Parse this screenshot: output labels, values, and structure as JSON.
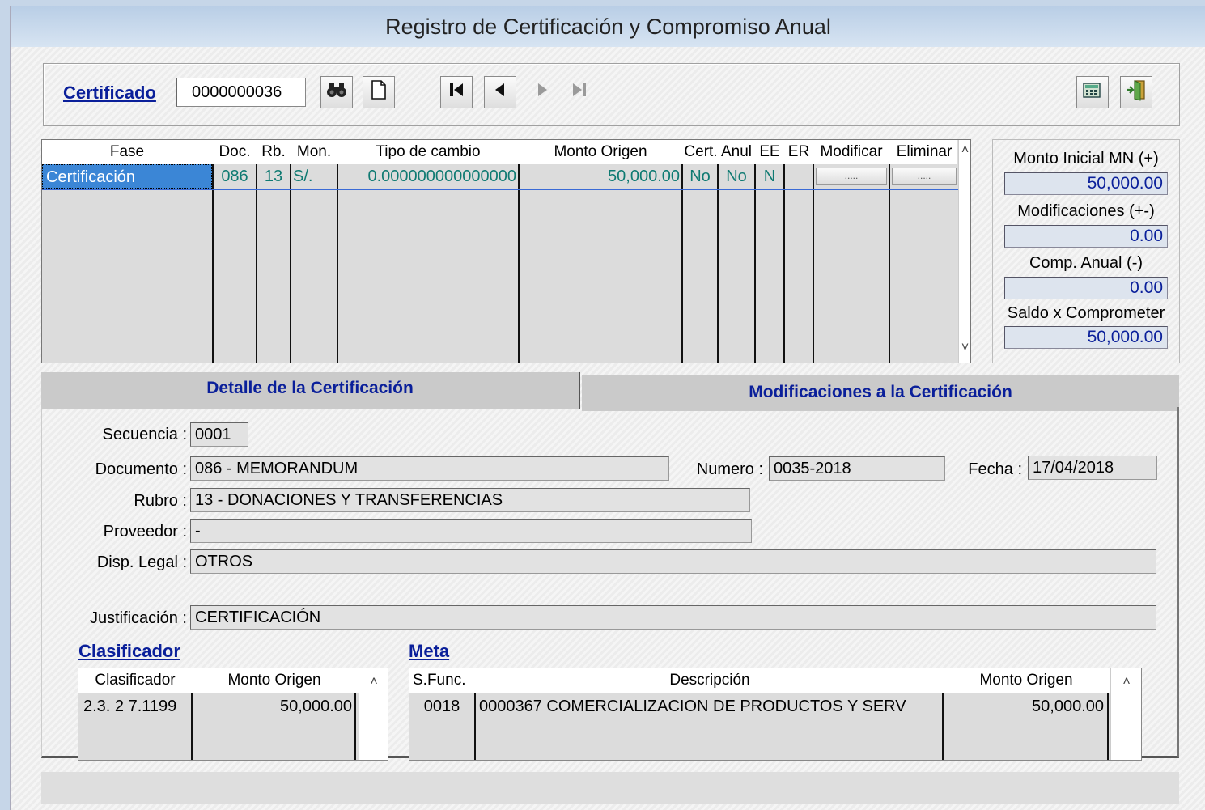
{
  "window": {
    "title": "Registro de Certificación y Compromiso Anual"
  },
  "toolbar": {
    "certificado_label": "Certificado",
    "certificado_value": "0000000036",
    "search_icon": "binoculars-icon",
    "new_icon": "new-document-icon",
    "calc_icon": "calculator-icon",
    "exit_icon": "exit-door-icon"
  },
  "grid": {
    "headers": [
      "Fase",
      "Doc.",
      "Rb.",
      "Mon.",
      "Tipo de cambio",
      "Monto Origen",
      "Cert.",
      "Anul",
      "EE",
      "ER",
      "Modificar",
      "Eliminar"
    ],
    "rows": [
      {
        "fase": "Certificación",
        "doc": "086",
        "rb": "13",
        "mon": "S/.",
        "tipo_cambio": "0.000000000000000",
        "monto_origen": "50,000.00",
        "cert": "No",
        "anul": "No",
        "ee": "N",
        "er": "",
        "modificar": ".....",
        "eliminar": "....."
      }
    ]
  },
  "summary": {
    "monto_inicial_label": "Monto Inicial MN (+)",
    "monto_inicial_value": "50,000.00",
    "modificaciones_label": "Modificaciones (+-)",
    "modificaciones_value": "0.00",
    "comp_anual_label": "Comp. Anual (-)",
    "comp_anual_value": "0.00",
    "saldo_label": "Saldo x Comprometer",
    "saldo_value": "50,000.00"
  },
  "tabs": [
    {
      "label": "Detalle de la Certificación",
      "active": true
    },
    {
      "label": "Modificaciones a la Certificación",
      "active": false
    }
  ],
  "detail": {
    "secuencia_label": "Secuencia :",
    "secuencia_value": "0001",
    "documento_label": "Documento :",
    "documento_value": "086 - MEMORANDUM",
    "numero_label": "Numero :",
    "numero_value": "0035-2018",
    "fecha_label": "Fecha :",
    "fecha_value": "17/04/2018",
    "rubro_label": "Rubro :",
    "rubro_value": "13 - DONACIONES Y TRANSFERENCIAS",
    "proveedor_label": "Proveedor :",
    "proveedor_value": "-",
    "disp_legal_label": "Disp. Legal :",
    "disp_legal_value": "OTROS",
    "justificacion_label": "Justificación :",
    "justificacion_value": "CERTIFICACIÓN"
  },
  "clasificador": {
    "title": "Clasificador",
    "headers": [
      "Clasificador",
      "Monto Origen"
    ],
    "rows": [
      {
        "clasificador": "2.3. 2 7.1199",
        "monto": "50,000.00"
      }
    ]
  },
  "meta": {
    "title": "Meta",
    "headers": [
      "S.Func.",
      "Descripción",
      "Monto Origen"
    ],
    "rows": [
      {
        "sfunc": "0018",
        "descripcion": "0000367  COMERCIALIZACION DE PRODUCTOS Y SERV",
        "monto": "50,000.00"
      }
    ]
  },
  "colors": {
    "accent_link": "#0a1f9a",
    "selection": "#3b86d6",
    "grid_text": "#0f7a72"
  }
}
